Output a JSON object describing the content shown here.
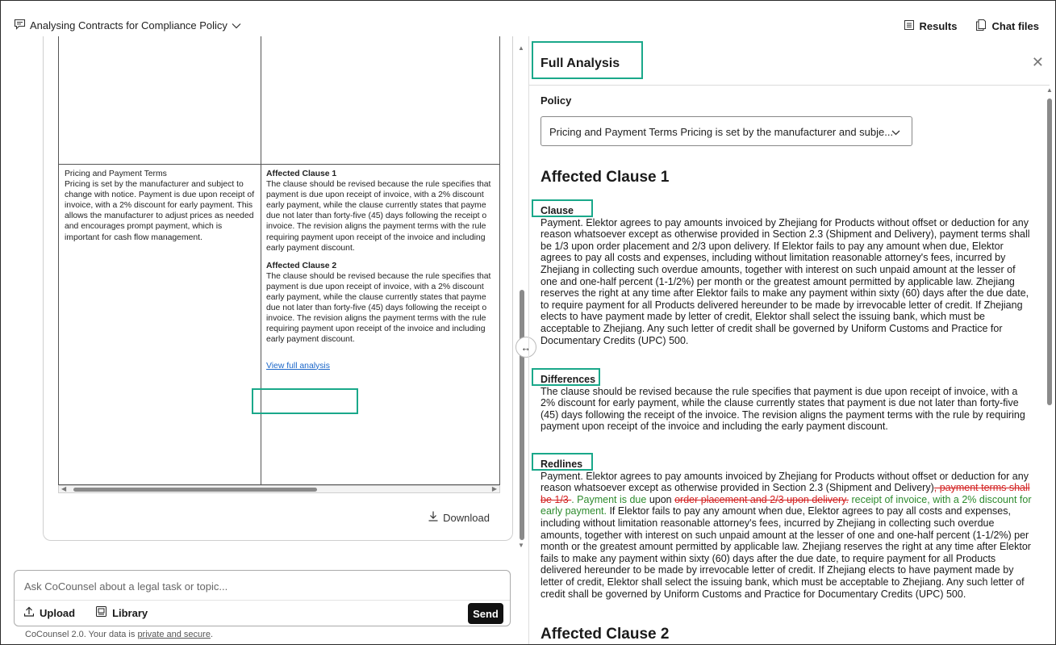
{
  "header": {
    "chat_title": "Analysing Contracts for Compliance Policy",
    "results_label": "Results",
    "chat_files_label": "Chat files"
  },
  "table": {
    "cell_policy": "Pricing and Payment Terms\nPricing is set by the manufacturer and subject to change with notice. Payment is due upon receipt of invoice, with a 2% discount for early payment. This allows the manufacturer to adjust prices as needed and encourages prompt payment, which is important for cash flow management.",
    "clause1_title": "Affected Clause 1",
    "clause1_lines": [
      "The clause should be revised because the rule specifies that",
      "payment is due upon receipt of invoice, with a 2% discount",
      "early payment, while the clause currently states that payme",
      "due not later than forty-five (45) days following the receipt o",
      "invoice. The revision aligns the payment terms with the rule",
      "requiring payment upon receipt of the invoice and including",
      "early payment discount."
    ],
    "clause2_title": "Affected Clause 2",
    "clause2_lines": [
      "The clause should be revised because the rule specifies that",
      "payment is due upon receipt of invoice, with a 2% discount",
      "early payment, while the clause currently states that payme",
      "due not later than forty-five (45) days following the receipt o",
      "invoice. The revision aligns the payment terms with the rule",
      "requiring payment upon receipt of the invoice and including",
      "early payment discount."
    ],
    "view_full_analysis": "View full analysis",
    "download_label": "Download"
  },
  "composer": {
    "placeholder": "Ask CoCounsel about a legal task or topic...",
    "upload_label": "Upload",
    "library_label": "Library",
    "send_label": "Send",
    "footer_prefix": "CoCounsel 2.0. Your data is ",
    "footer_link": "private and secure",
    "footer_suffix": "."
  },
  "analysis": {
    "title": "Full Analysis",
    "policy_label": "Policy",
    "policy_value": "Pricing and Payment Terms Pricing is set by the manufacturer and subje...",
    "clause1_heading": "Affected Clause 1",
    "clause_label": "Clause",
    "clause_text": "Payment. Elektor agrees to pay amounts invoiced by Zhejiang for Products without offset or deduction for any reason whatsoever except as otherwise provided in Section 2.3 (Shipment and Delivery), payment terms shall be 1/3 upon order placement and 2/3 upon delivery. If Elektor fails to pay any amount when due, Elektor agrees to pay all costs and expenses, including without limitation reasonable attorney's fees, incurred by Zhejiang in collecting such overdue amounts, together with interest on such unpaid amount at the lesser of one and one-half percent (1-1/2%) per month or the greatest amount permitted by applicable law. Zhejiang reserves the right at any time after Elektor fails to make any payment within sixty (60) days after the due date, to require payment for all Products delivered hereunder to be made by irrevocable letter of credit. If Zhejiang elects to have payment made by letter of credit, Elektor shall select the issuing bank, which must be acceptable to Zhejiang. Any such letter of credit shall be governed by Uniform Customs and Practice for Documentary Credits (UPC) 500.",
    "differences_label": "Differences",
    "differences_text": "The clause should be revised because the rule specifies that payment is due upon receipt of invoice, with a 2% discount for early payment, while the clause currently states that payment is due not later than forty-five (45) days following the receipt of the invoice. The revision aligns the payment terms with the rule by requiring payment upon receipt of the invoice and including the early payment discount.",
    "redlines_label": "Redlines",
    "redlines": {
      "t1": "Payment. Elektor agrees to pay amounts invoiced by Zhejiang for Products without offset or deduction for any reason whatsoever except as otherwise provided in Section 2.3 (Shipment and Delivery)",
      "del1": ", payment terms shall be 1/3 ",
      "ins1": ". Payment is due ",
      "t2": "upon ",
      "del2": "order placement and 2/3 upon delivery.",
      "ins2": " receipt of invoice, with a 2% discount for early payment.",
      "t3": " If Elektor fails to pay any amount when due, Elektor agrees to pay all costs and expenses, including without limitation reasonable attorney's fees, incurred by Zhejiang in collecting such overdue amounts, together with interest on such unpaid amount at the lesser of one and one-half percent (1-1/2%) per month or the greatest amount permitted by applicable law. Zhejiang reserves the right at any time after Elektor fails to make any payment within sixty (60) days after the due date, to require payment for all Products delivered hereunder to be made by irrevocable letter of credit. If Zhejiang elects to have payment made by letter of credit, Elektor shall select the issuing bank, which must be acceptable to Zhejiang. Any such letter of credit shall be governed by Uniform Customs and Practice for Documentary Credits (UPC) 500."
    },
    "clause2_heading": "Affected Clause 2"
  },
  "colors": {
    "highlight": "#1aa88a",
    "deletion": "#d32222",
    "insertion": "#2e8b2e",
    "link": "#1a66c9"
  }
}
